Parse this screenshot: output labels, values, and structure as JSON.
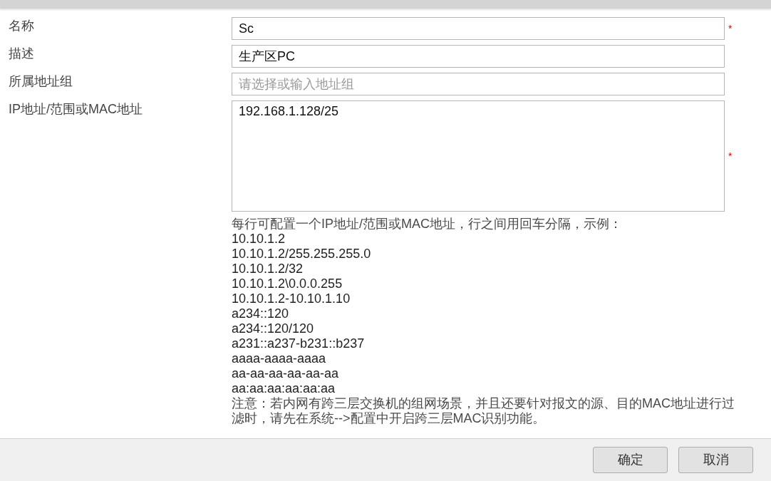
{
  "fields": [
    {
      "label": "名称",
      "kind": "input",
      "value": "Sc",
      "required_mark": "*"
    },
    {
      "label": "描述",
      "kind": "input",
      "value": "生产区PC"
    },
    {
      "label": "所属地址组",
      "kind": "input",
      "placeholder": "请选择或输入地址组"
    },
    {
      "label": "IP地址/范围或MAC地址",
      "kind": "textarea",
      "value": "192.168.1.128/25",
      "required_mark": "*"
    }
  ],
  "help": {
    "intro": "每行可配置一个IP地址/范围或MAC地址，行之间用回车分隔，示例：",
    "examples": [
      "10.10.1.2",
      "10.10.1.2/255.255.255.0",
      "10.10.1.2/32",
      "10.10.1.2\\0.0.0.255",
      "10.10.1.2-10.10.1.10",
      "a234::120",
      "a234::120/120",
      "a231::a237-b231::b237",
      "aaaa-aaaa-aaaa",
      "aa-aa-aa-aa-aa-aa",
      "aa:aa:aa:aa:aa:aa"
    ],
    "note": "注意：若内网有跨三层交换机的组网场景，并且还要针对报文的源、目的MAC地址进行过滤时，请先在系统-->配置中开启跨三层MAC识别功能。"
  },
  "buttons": [
    "确定",
    "取消"
  ]
}
